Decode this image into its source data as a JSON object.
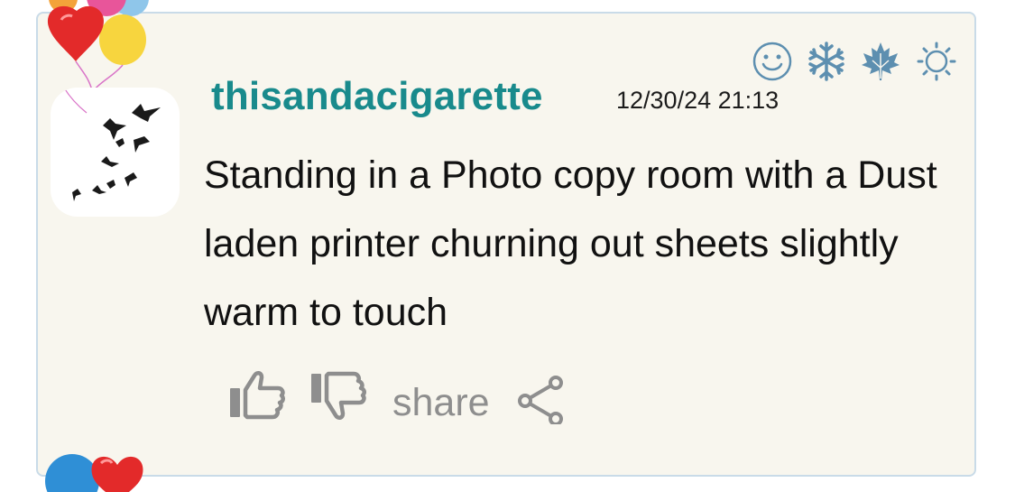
{
  "post": {
    "username": "thisandacigarette",
    "timestamp": "12/30/24 21:13",
    "message": "Standing in a Photo copy room with a Dust laden printer churning out sheets slightly warm to touch"
  },
  "reactions": [
    {
      "icon": "smiley-icon"
    },
    {
      "icon": "snowflake-icon"
    },
    {
      "icon": "maple-leaf-icon"
    },
    {
      "icon": "sun-icon"
    }
  ],
  "actions": {
    "share_label": "share"
  },
  "colors": {
    "username": "#198a8c",
    "reaction_blue": "#5d8fb0",
    "action_gray": "#8e8e8e",
    "card_bg": "#f8f6ee",
    "card_border": "#c9dbe8"
  }
}
